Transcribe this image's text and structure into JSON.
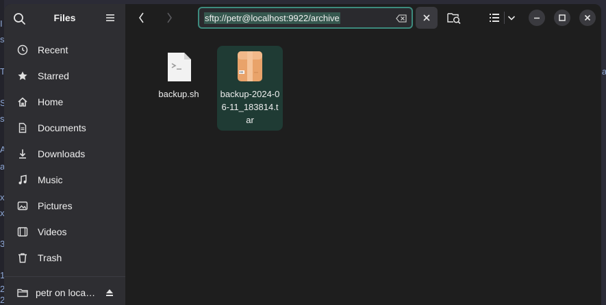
{
  "background": {
    "left_glyphs": [
      "I",
      "s",
      "T",
      "S",
      "s",
      "A",
      "a",
      "x",
      "x",
      "3",
      "1",
      "2",
      "2"
    ],
    "right_glyph": "a"
  },
  "sidebar": {
    "title": "Files",
    "items": [
      {
        "label": "Recent",
        "icon": "clock-icon"
      },
      {
        "label": "Starred",
        "icon": "star-icon"
      },
      {
        "label": "Home",
        "icon": "home-icon"
      },
      {
        "label": "Documents",
        "icon": "document-icon"
      },
      {
        "label": "Downloads",
        "icon": "download-icon"
      },
      {
        "label": "Music",
        "icon": "music-icon"
      },
      {
        "label": "Pictures",
        "icon": "picture-icon"
      },
      {
        "label": "Videos",
        "icon": "video-icon"
      },
      {
        "label": "Trash",
        "icon": "trash-icon"
      }
    ],
    "network": {
      "label": "petr on loca…",
      "icon": "folder-icon"
    }
  },
  "toolbar": {
    "path": "sftp://petr@localhost:9922/archive"
  },
  "files": [
    {
      "name": "backup.sh",
      "type": "script",
      "selected": false
    },
    {
      "name": "backup-2024-06-11_183814.tar",
      "type": "archive",
      "selected": true
    }
  ],
  "colors": {
    "accent": "#3d8b7e",
    "selection": "#1f3b34",
    "sidebar": "#2e2e32",
    "content": "#1e1e1e"
  }
}
